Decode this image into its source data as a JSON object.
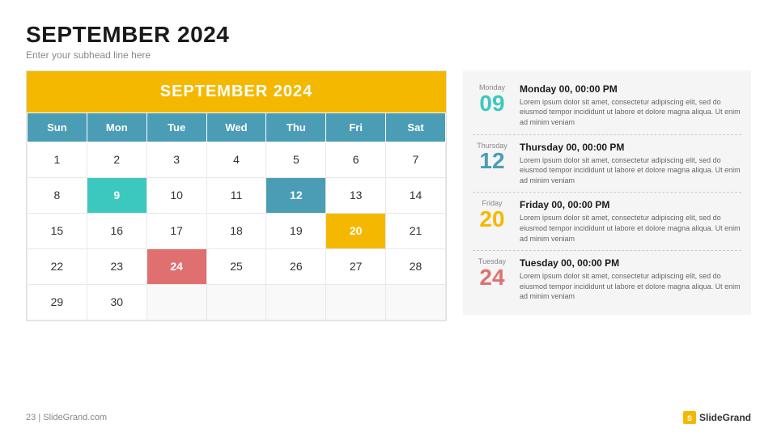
{
  "header": {
    "title": "SEPTEMBER 2024",
    "subtitle": "Enter your subhead line here"
  },
  "calendar": {
    "month_label": "SEPTEMBER 2024",
    "days_header": [
      "Sun",
      "Mon",
      "Tue",
      "Wed",
      "Thu",
      "Fri",
      "Sat"
    ],
    "weeks": [
      [
        {
          "day": "1",
          "highlight": null
        },
        {
          "day": "2",
          "highlight": null
        },
        {
          "day": "3",
          "highlight": null
        },
        {
          "day": "4",
          "highlight": null
        },
        {
          "day": "5",
          "highlight": null
        },
        {
          "day": "6",
          "highlight": null
        },
        {
          "day": "7",
          "highlight": null
        }
      ],
      [
        {
          "day": "8",
          "highlight": null
        },
        {
          "day": "9",
          "highlight": "green"
        },
        {
          "day": "10",
          "highlight": null
        },
        {
          "day": "11",
          "highlight": null
        },
        {
          "day": "12",
          "highlight": "blue"
        },
        {
          "day": "13",
          "highlight": null
        },
        {
          "day": "14",
          "highlight": null
        }
      ],
      [
        {
          "day": "15",
          "highlight": null
        },
        {
          "day": "16",
          "highlight": null
        },
        {
          "day": "17",
          "highlight": null
        },
        {
          "day": "18",
          "highlight": null
        },
        {
          "day": "19",
          "highlight": null
        },
        {
          "day": "20",
          "highlight": "yellow"
        },
        {
          "day": "21",
          "highlight": null
        }
      ],
      [
        {
          "day": "22",
          "highlight": null
        },
        {
          "day": "23",
          "highlight": null
        },
        {
          "day": "24",
          "highlight": "red"
        },
        {
          "day": "25",
          "highlight": null
        },
        {
          "day": "26",
          "highlight": null
        },
        {
          "day": "27",
          "highlight": null
        },
        {
          "day": "28",
          "highlight": null
        }
      ],
      [
        {
          "day": "29",
          "highlight": null
        },
        {
          "day": "30",
          "highlight": null
        },
        {
          "day": "",
          "highlight": null
        },
        {
          "day": "",
          "highlight": null
        },
        {
          "day": "",
          "highlight": null
        },
        {
          "day": "",
          "highlight": null
        },
        {
          "day": "",
          "highlight": null
        }
      ]
    ]
  },
  "events": [
    {
      "day_name": "Monday",
      "date": "09",
      "color": "teal",
      "title": "Monday 00, 00:00 PM",
      "desc": "Lorem ipsum dolor sit amet, consectetur adipiscing elit, sed do eiusmod tempor incididunt ut labore et dolore magna aliqua. Ut enim ad minim veniam"
    },
    {
      "day_name": "Thursday",
      "date": "12",
      "color": "blue",
      "title": "Thursday 00, 00:00 PM",
      "desc": "Lorem ipsum dolor sit amet, consectetur adipiscing elit, sed do eiusmod tempor incididunt ut labore et dolore magna aliqua. Ut enim ad minim veniam"
    },
    {
      "day_name": "Friday",
      "date": "20",
      "color": "yellow",
      "title": "Friday 00, 00:00 PM",
      "desc": "Lorem ipsum dolor sit amet, consectetur adipiscing elit, sed do eiusmod tempor incididunt ut labore et dolore magna aliqua. Ut enim ad minim veniam"
    },
    {
      "day_name": "Tuesday",
      "date": "24",
      "color": "red",
      "title": "Tuesday 00, 00:00 PM",
      "desc": "Lorem ipsum dolor sit amet, consectetur adipiscing elit, sed do eiusmod tempor incididunt ut labore et dolore magna aliqua. Ut enim ad minim veniam"
    }
  ],
  "footer": {
    "page_num": "23",
    "website": "| SlideGrand.com",
    "brand": "SlideGrand"
  }
}
